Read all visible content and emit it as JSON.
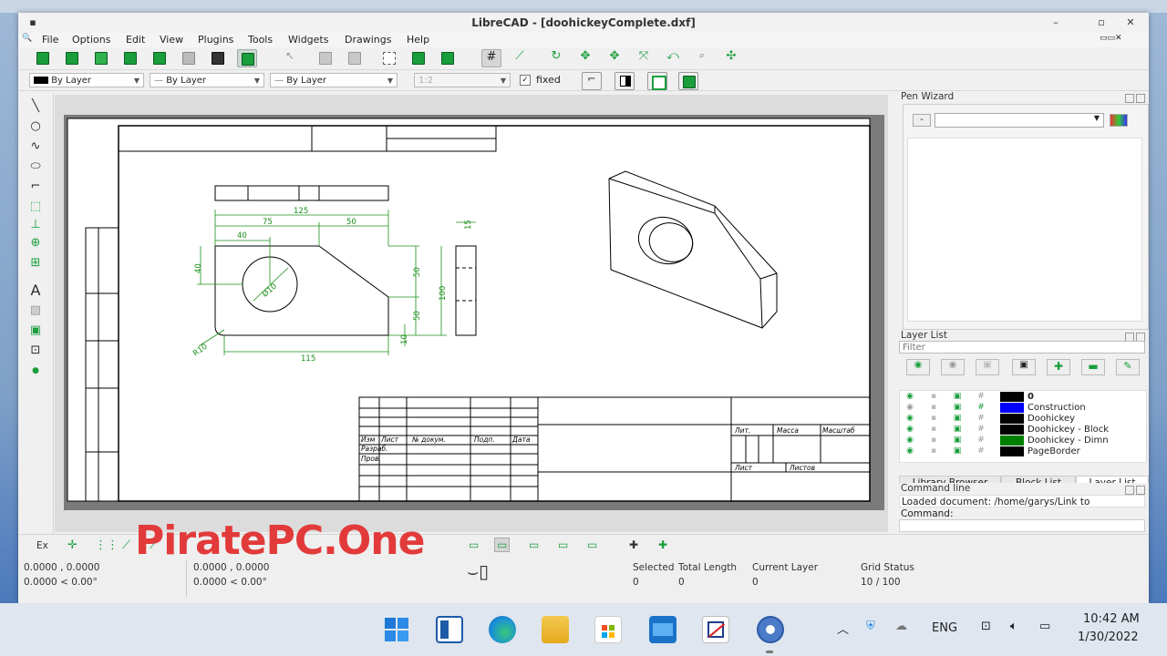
{
  "window": {
    "title": "LibreCAD - [doohickeyComplete.dxf]",
    "buttons": {
      "minimize": "–",
      "maximize": "▫",
      "close": "✕"
    }
  },
  "menu": [
    "File",
    "Options",
    "Edit",
    "View",
    "Plugins",
    "Tools",
    "Widgets",
    "Drawings",
    "Help"
  ],
  "property_bar": {
    "color": "By Layer",
    "linetype": "By Layer",
    "linewidth": "By Layer",
    "scale": "1:2",
    "fixed_label": "fixed"
  },
  "drawing": {
    "dimensions": {
      "d125": "125",
      "d75": "75",
      "d50": "50",
      "d40": "40",
      "dh40": "40",
      "dv50a": "50",
      "dv50b": "50",
      "d100": "100",
      "d15": "15",
      "d10": "10",
      "d115": "115",
      "r10": "R10",
      "dia": "Ø10"
    },
    "title_block": {
      "c1": "Изм",
      "c2": "Лист",
      "c3": "№ докум.",
      "c4": "Подп.",
      "c5": "Дата",
      "r1": "Разраб.",
      "r2": "Пров.",
      "lit": "Лит.",
      "mass": "Масса",
      "scale": "Масштаб",
      "sheet": "Лист",
      "sheets": "Листов"
    }
  },
  "pen_wizard": {
    "title": "Pen Wizard",
    "minus": "-"
  },
  "layer_list": {
    "title": "Layer List",
    "filter_placeholder": "Filter",
    "layers": [
      {
        "name": "0",
        "color": "#000000",
        "bold": true
      },
      {
        "name": "Construction",
        "color": "#0000ff",
        "bold": false
      },
      {
        "name": "Doohickey",
        "color": "#000000",
        "bold": false
      },
      {
        "name": "Doohickey - Block",
        "color": "#000000",
        "bold": false
      },
      {
        "name": "Doohickey - Dimn",
        "color": "#008000",
        "bold": false
      },
      {
        "name": "PageBorder",
        "color": "#000000",
        "bold": false
      }
    ]
  },
  "dock_tabs": [
    "Library Browser",
    "Block List",
    "Layer List"
  ],
  "command_line": {
    "title": "Command line",
    "output": "Loaded document: /home/garys/Link to",
    "prompt": "Command:"
  },
  "status": {
    "snap_label": "Ex",
    "abs_coord": "0.0000 , 0.0000",
    "abs_polar": "0.0000 < 0.00°",
    "rel_coord": "0.0000 , 0.0000",
    "rel_polar": "0.0000 < 0.00°",
    "selected_label": "Selected",
    "selected_value": "0",
    "total_length_label": "Total Length",
    "total_length_value": "0",
    "current_layer_label": "Current Layer",
    "current_layer_value": "0",
    "grid_status_label": "Grid Status",
    "grid_status_value": "10 / 100"
  },
  "watermark": "PiratePC.One",
  "taskbar": {
    "lang": "ENG",
    "time": "10:42 AM",
    "date": "1/30/2022"
  }
}
